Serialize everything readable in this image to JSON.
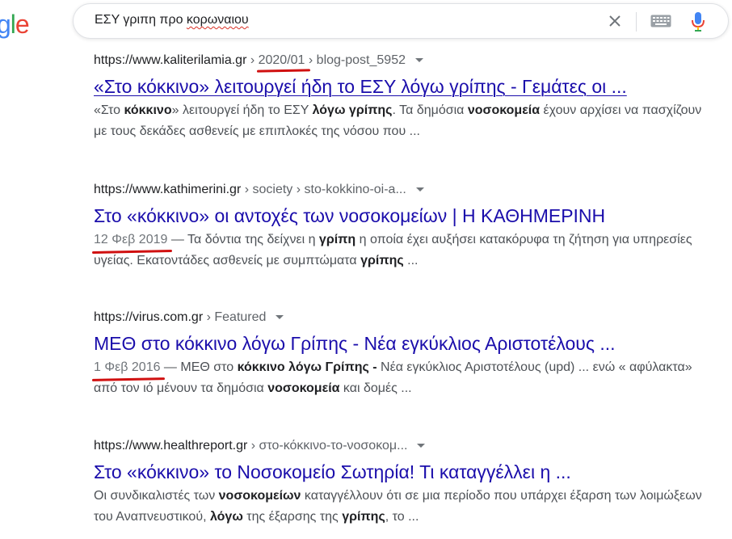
{
  "logo": {
    "text": "gle",
    "colors": [
      "#4285F4",
      "#34A853",
      "#EA4335"
    ]
  },
  "search": {
    "query_prefix": "ΕΣΥ γριπη προ ",
    "query_misspelled": "κορωναιου"
  },
  "colors": {
    "link": "#1a0dab",
    "annotation": "#d01010"
  },
  "results": [
    {
      "site": "https://www.kaliterilamia.gr",
      "path_pre": " › ",
      "path_mark": "2020/01",
      "path_post": " › blog-post_5952",
      "title": "«Στο κόκκινο» λειτουργεί ήδη το ΕΣΥ λόγω γρίπης - Γεμάτες οι ...",
      "snippet": [
        {
          "t": "«Στο "
        },
        {
          "t": "κόκκινο",
          "b": true
        },
        {
          "t": "» λειτουργεί ήδη το ΕΣΥ "
        },
        {
          "t": "λόγω γρίπης",
          "b": true
        },
        {
          "t": ". Τα δημόσια "
        },
        {
          "t": "νοσοκομεία",
          "b": true
        },
        {
          "t": " έχουν αρχίσει να πασχίζουν με τους δεκάδες ασθενείς με επιπλοκές της νόσου που ..."
        }
      ]
    },
    {
      "site": "https://www.kathimerini.gr",
      "path": " › society › sto-kokkino-oi-a...",
      "title": "Στο «κόκκινο» οι αντοχές των νοσοκομείων | Η ΚΑΘΗΜΕΡΙΝΗ",
      "date": "12 Φεβ 2019",
      "snippet": [
        {
          "t": " — Τα δόντια της δείχνει η "
        },
        {
          "t": "γρίπη",
          "b": true
        },
        {
          "t": " η οποία έχει αυξήσει κατακόρυφα τη ζήτηση για υπηρεσίες υγείας. Εκατοντάδες ασθενείς με συμπτώματα "
        },
        {
          "t": "γρίπης",
          "b": true
        },
        {
          "t": " ..."
        }
      ]
    },
    {
      "site": "https://virus.com.gr",
      "path": " › Featured",
      "title": "ΜΕΘ στο κόκκινο λόγω Γρίπης - Νέα εγκύκλιος Αριστοτέλους ...",
      "date": "1 Φεβ 2016",
      "snippet": [
        {
          "t": " — ΜΕΘ στο "
        },
        {
          "t": "κόκκινο λόγω Γρίπης -",
          "b": true
        },
        {
          "t": " Νέα εγκύκλιος Αριστοτέλους (upd) ... ενώ « αφύλακτα» από τον ιό μένουν τα δημόσια "
        },
        {
          "t": "νοσοκομεία",
          "b": true
        },
        {
          "t": " και δομές ..."
        }
      ]
    },
    {
      "site": "https://www.healthreport.gr",
      "path": " › στο-κόκκινο-το-νοσοκομ...",
      "title": "Στο «κόκκινο» το Νοσοκομείο Σωτηρία! Τι καταγγέλλει η ...",
      "snippet": [
        {
          "t": "Οι συνδικαλιστές των "
        },
        {
          "t": "νοσοκομείων",
          "b": true
        },
        {
          "t": " καταγγέλλουν ότι σε μια περίοδο που υπάρχει έξαρση των λοιμώξεων του Αναπνευστικού, "
        },
        {
          "t": "λόγω",
          "b": true
        },
        {
          "t": " της έξαρσης της "
        },
        {
          "t": "γρίπης",
          "b": true
        },
        {
          "t": ", το ..."
        }
      ]
    }
  ]
}
